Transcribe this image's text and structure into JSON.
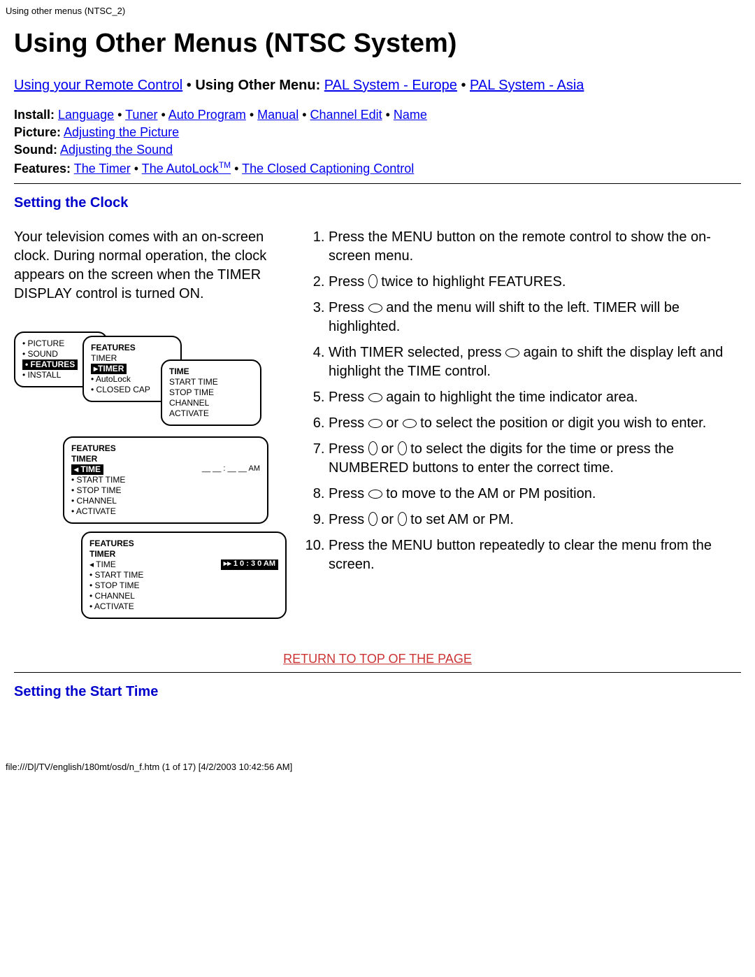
{
  "header_small": "Using other menus (NTSC_2)",
  "h1": "Using Other Menus (NTSC System)",
  "topnav": {
    "link1": "Using your Remote Control",
    "bold": "Using Other Menu:",
    "link2": "PAL System - Europe",
    "link3": "PAL System - Asia"
  },
  "sublinks": {
    "install_label": "Install:",
    "install": [
      "Language",
      "Tuner",
      "Auto Program",
      "Manual",
      "Channel Edit",
      "Name"
    ],
    "picture_label": "Picture:",
    "picture_link": "Adjusting the Picture",
    "sound_label": "Sound:",
    "sound_link": "Adjusting the Sound",
    "features_label": "Features:",
    "features": [
      "The Timer",
      "The AutoLock",
      "The Closed Captioning Control"
    ],
    "tm": "TM"
  },
  "section1_title": "Setting the Clock",
  "intro_para": "Your television comes with an on-screen clock. During normal operation, the clock appears on the screen when the TIMER DISPLAY control is turned ON.",
  "steps": {
    "s1": "Press the MENU button on the remote control to show the on-screen menu.",
    "s2a": "Press ",
    "s2b": " twice to highlight FEATURES.",
    "s3a": "Press ",
    "s3b": " and the menu will shift to the left. TIMER will be highlighted.",
    "s4a": "With TIMER selected, press ",
    "s4b": " again to shift the display left and highlight the TIME control.",
    "s5a": "Press ",
    "s5b": " again to highlight the time indicator area.",
    "s6a": "Press ",
    "s6b": " or ",
    "s6c": " to select the position or digit you wish to enter.",
    "s7a": "Press ",
    "s7b": " or ",
    "s7c": " to select the digits for the time or press the NUMBERED buttons to enter the correct time.",
    "s8a": "Press ",
    "s8b": " to move to the AM or PM position.",
    "s9a": "Press ",
    "s9b": " or ",
    "s9c": " to set AM or PM.",
    "s10": "Press the MENU button repeatedly to clear the menu from the screen."
  },
  "diagram": {
    "p1": {
      "items": [
        "• PICTURE",
        "• SOUND",
        "• FEATURES",
        "• INSTALL"
      ],
      "sel_idx": 2
    },
    "p2": {
      "hdr": "FEATURES",
      "items": [
        "TIMER",
        "▸TIMER",
        "• AutoLock",
        "• CLOSED CAP"
      ],
      "sel_idx": 1
    },
    "p3": {
      "items": [
        "TIME",
        "START TIME",
        "STOP TIME",
        "CHANNEL",
        "ACTIVATE"
      ]
    },
    "p4": {
      "hdr": "FEATURES",
      "sub": "TIMER",
      "items": [
        "◂ TIME",
        "• START TIME",
        "• STOP TIME",
        "• CHANNEL",
        "• ACTIVATE"
      ],
      "sel_idx": 0,
      "right": "__ __ : __ __  AM"
    },
    "p5": {
      "hdr": "FEATURES",
      "sub": "TIMER",
      "items": [
        "◂ TIME",
        "• START TIME",
        "• STOP TIME",
        "• CHANNEL",
        "• ACTIVATE"
      ],
      "right": "▸▸  1 0 : 3 0  AM"
    }
  },
  "return_link": "RETURN TO TOP OF THE PAGE",
  "section2_title": "Setting the Start Time",
  "footer": "file:///D|/TV/english/180mt/osd/n_f.htm (1 of 17) [4/2/2003 10:42:56 AM]"
}
